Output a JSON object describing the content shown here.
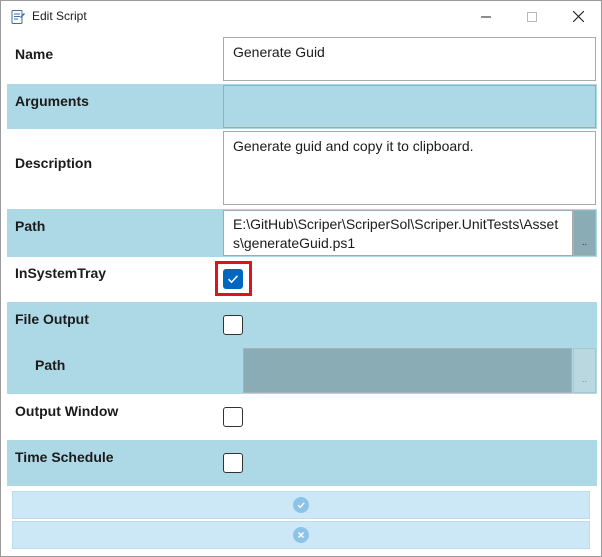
{
  "window": {
    "title": "Edit Script"
  },
  "form": {
    "name_label": "Name",
    "name_value": "Generate Guid",
    "arguments_label": "Arguments",
    "arguments_value": "",
    "description_label": "Description",
    "description_value": "Generate guid and copy it to clipboard.",
    "path_label": "Path",
    "path_value": "E:\\GitHub\\Scriper\\ScriperSol\\Scriper.UnitTests\\Assets\\generateGuid.ps1",
    "browse_label": "..",
    "insystemtray_label": "InSystemTray",
    "insystemtray_checked": true,
    "fileoutput_label": "File Output",
    "fileoutput_checked": false,
    "fileoutput_path_label": "Path",
    "fileoutput_path_value": "",
    "fileoutput_browse_label": "..",
    "outputwindow_label": "Output Window",
    "outputwindow_checked": false,
    "timeschedule_label": "Time Schedule",
    "timeschedule_checked": false
  },
  "actions": {
    "ok_icon": "check-circle-icon",
    "cancel_icon": "x-circle-icon"
  },
  "colors": {
    "row_band": "#add8e6",
    "checkbox_checked": "#0067c0",
    "highlight": "#e0121d",
    "action_bar": "#cce8f6"
  }
}
